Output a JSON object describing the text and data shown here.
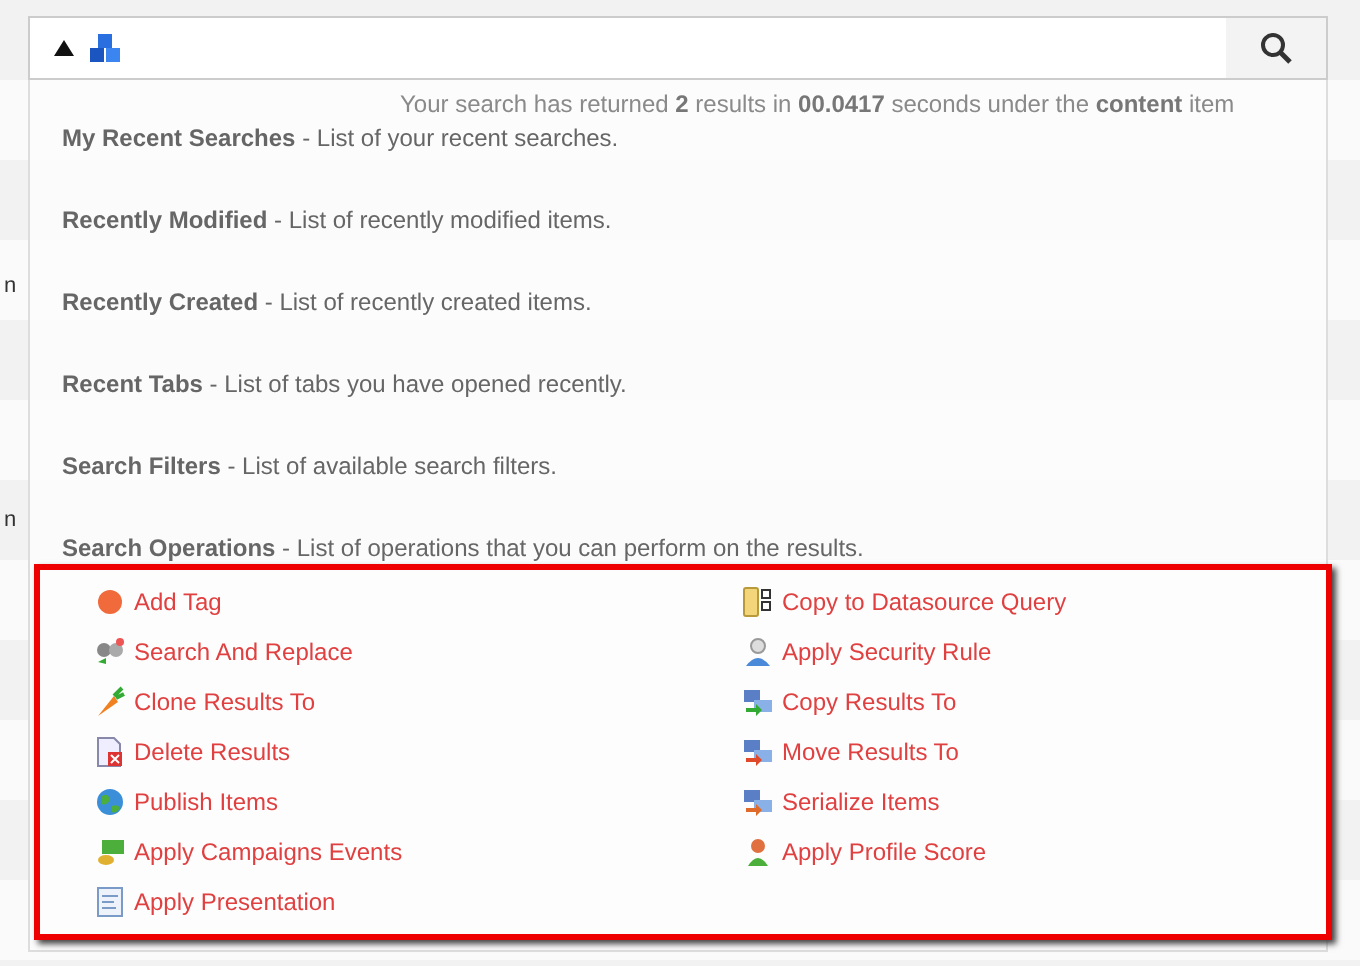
{
  "background": {
    "status_text": "Your search has returned **2** results in **00.0417** seconds under the **content** item",
    "edge_fragments": [
      "n",
      "n"
    ]
  },
  "menu": [
    {
      "title": "My Recent Searches",
      "description": " - List of your recent searches."
    },
    {
      "title": "Recently Modified",
      "description": " - List of recently modified items."
    },
    {
      "title": "Recently Created",
      "description": " - List of recently created items."
    },
    {
      "title": "Recent Tabs",
      "description": " - List of tabs you have opened recently."
    },
    {
      "title": "Search Filters",
      "description": " - List of available search filters."
    },
    {
      "title": "Search Operations",
      "description": " - List of operations that you can perform on the results."
    }
  ],
  "operations": [
    [
      {
        "label": "Add Tag",
        "kind": "tag"
      },
      {
        "label": "Search And Replace",
        "kind": "replace"
      },
      {
        "label": "Clone Results To",
        "kind": "clone"
      },
      {
        "label": "Delete Results",
        "kind": "delete"
      },
      {
        "label": "Publish Items",
        "kind": "publish"
      },
      {
        "label": "Apply Campaigns Events",
        "kind": "campaign"
      },
      {
        "label": "Apply Presentation",
        "kind": "presentation"
      }
    ],
    [
      {
        "label": "Copy to Datasource Query",
        "kind": "datasource"
      },
      {
        "label": "Apply Security Rule",
        "kind": "security"
      },
      {
        "label": "Copy Results To",
        "kind": "copy"
      },
      {
        "label": "Move Results To",
        "kind": "move"
      },
      {
        "label": "Serialize Items",
        "kind": "serialize"
      },
      {
        "label": "Apply Profile Score",
        "kind": "profile"
      }
    ]
  ]
}
